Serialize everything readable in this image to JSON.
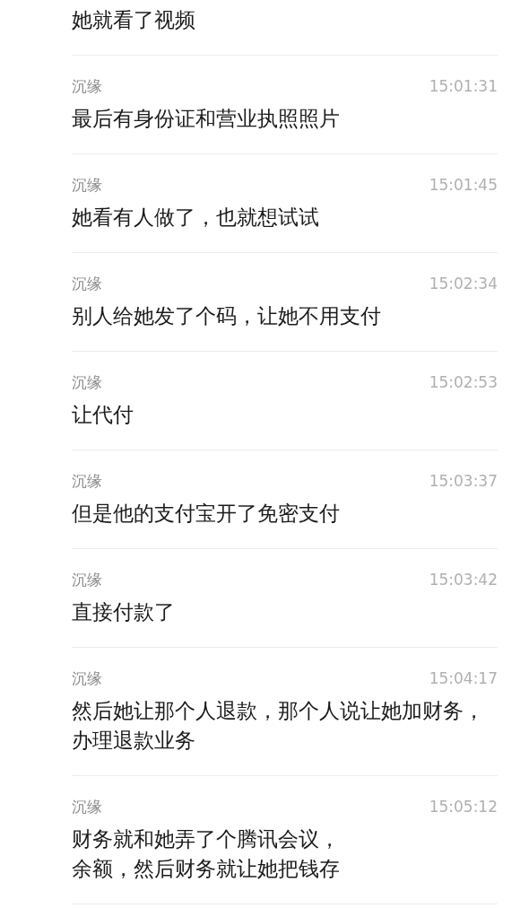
{
  "messages": [
    {
      "lines": [
        "她就看了视频"
      ]
    },
    {
      "sender": "沉缘",
      "time": "15:01:31",
      "lines": [
        "最后有身份证和营业执照照片"
      ]
    },
    {
      "sender": "沉缘",
      "time": "15:01:45",
      "lines": [
        "她看有人做了，也就想试试"
      ]
    },
    {
      "sender": "沉缘",
      "time": "15:02:34",
      "lines": [
        "别人给她发了个码，让她不用支付"
      ]
    },
    {
      "sender": "沉缘",
      "time": "15:02:53",
      "lines": [
        "让代付"
      ]
    },
    {
      "sender": "沉缘",
      "time": "15:03:37",
      "lines": [
        "但是他的支付宝开了免密支付"
      ]
    },
    {
      "sender": "沉缘",
      "time": "15:03:42",
      "lines": [
        "直接付款了"
      ]
    },
    {
      "sender": "沉缘",
      "time": "15:04:17",
      "lines": [
        "然后她让那个人退款，那个人说让她加财务，办理退款业务"
      ]
    },
    {
      "sender": "沉缘",
      "time": "15:05:12",
      "lines": [
        "财务就和她弄了个腾讯会议，",
        "余额，然后财务就让她把钱存"
      ]
    }
  ]
}
